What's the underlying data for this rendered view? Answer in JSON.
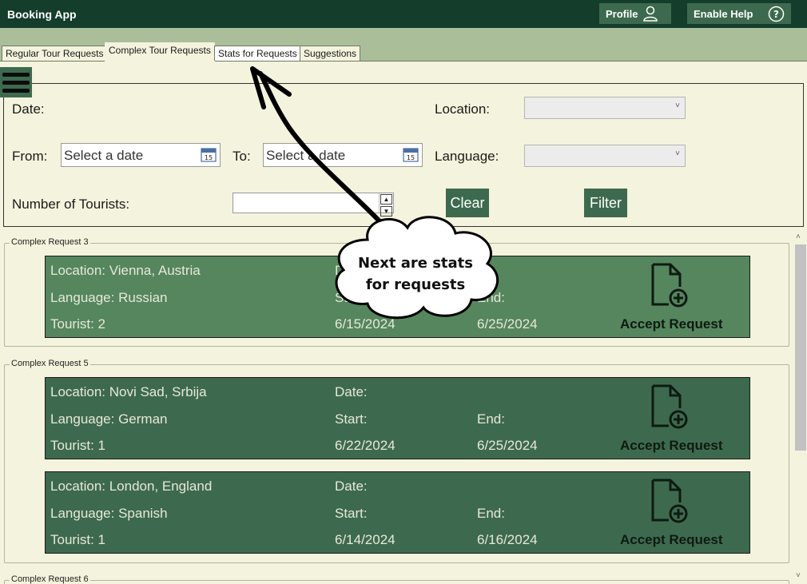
{
  "header": {
    "app_title": "Booking App",
    "profile_label": "Profile",
    "help_label": "Enable Help"
  },
  "tabs": [
    {
      "label": "Regular Tour Requests"
    },
    {
      "label": "Complex Tour Requests"
    },
    {
      "label": "Stats for Requests"
    },
    {
      "label": "Suggestions"
    }
  ],
  "filter": {
    "date_label": "Date:",
    "from_label": "From:",
    "from_placeholder": "Select a date",
    "to_label": "To:",
    "to_placeholder": "Select a date",
    "location_label": "Location:",
    "language_label": "Language:",
    "tourists_label": "Number of Tourists:",
    "clear_label": "Clear",
    "filter_label": "Filter",
    "calendar_day": "15"
  },
  "groups": [
    {
      "title": "Complex Request 3",
      "requests": [
        {
          "location": "Location: Vienna, Austria",
          "language": "Language: Russian",
          "tourist": "Tourist: 2",
          "date_label": "Date:",
          "start_label": "Start:",
          "end_label": "End:",
          "start": "6/15/2024",
          "end": "6/25/2024",
          "accept": "Accept Request"
        }
      ]
    },
    {
      "title": "Complex Request 5",
      "requests": [
        {
          "location": "Location: Novi Sad, Srbija",
          "language": "Language: German",
          "tourist": "Tourist: 1",
          "date_label": "Date:",
          "start_label": "Start:",
          "end_label": "End:",
          "start": "6/22/2024",
          "end": "6/25/2024",
          "accept": "Accept Request"
        },
        {
          "location": "Location: London, England",
          "language": "Language: Spanish",
          "tourist": "Tourist: 1",
          "date_label": "Date:",
          "start_label": "Start:",
          "end_label": "End:",
          "start": "6/14/2024",
          "end": "6/16/2024",
          "accept": "Accept Request"
        }
      ]
    },
    {
      "title": "Complex Request 6",
      "requests": []
    }
  ],
  "annotation": {
    "line1": "Next are stats",
    "line2": "for requests"
  },
  "colors": {
    "header_bg": "#143d2c",
    "tabbar_bg": "#abbe9a",
    "page_bg": "#f4f3dd",
    "button_green": "#3d6a4e",
    "card_light": "#55865e",
    "card_dark": "#3d6a4e"
  },
  "icons": {
    "profile": "user-icon",
    "help": "question-circle-icon",
    "menu": "hamburger-icon",
    "calendar": "calendar-icon",
    "accept": "document-add-icon"
  }
}
